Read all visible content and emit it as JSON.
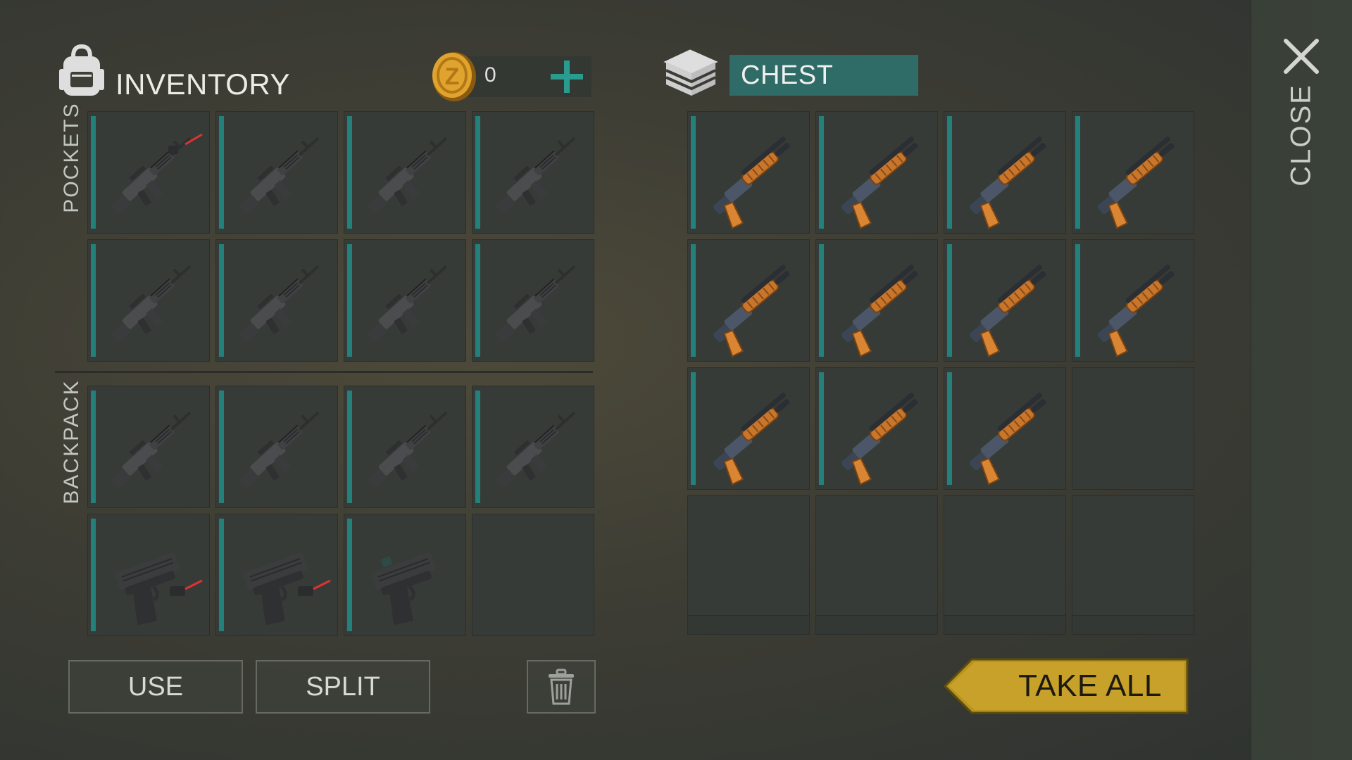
{
  "inventory": {
    "title": "INVENTORY",
    "coins": "0"
  },
  "chest": {
    "title": "CHEST"
  },
  "sections": {
    "pockets": "POCKETS",
    "backpack": "BACKPACK"
  },
  "close": {
    "label": "CLOSE"
  },
  "buttons": {
    "use": "USE",
    "split": "SPLIT",
    "take_all": "TAKE ALL"
  },
  "pockets_slots": [
    "rifle-laser",
    "rifle",
    "rifle",
    "rifle",
    "rifle",
    "rifle",
    "rifle",
    "rifle"
  ],
  "backpack_slots": [
    "rifle",
    "rifle",
    "rifle",
    "rifle",
    "pistol-laser",
    "pistol-laser",
    "pistol-sight",
    "empty"
  ],
  "chest_slots": [
    "shotgun",
    "shotgun",
    "shotgun",
    "shotgun",
    "shotgun",
    "shotgun",
    "shotgun",
    "shotgun",
    "shotgun",
    "shotgun",
    "shotgun",
    "empty",
    "empty",
    "empty",
    "empty",
    "empty"
  ],
  "colors": {
    "accent_teal": "#23807a",
    "chest_header": "#2f6b67",
    "take_all": "#c9a227"
  }
}
